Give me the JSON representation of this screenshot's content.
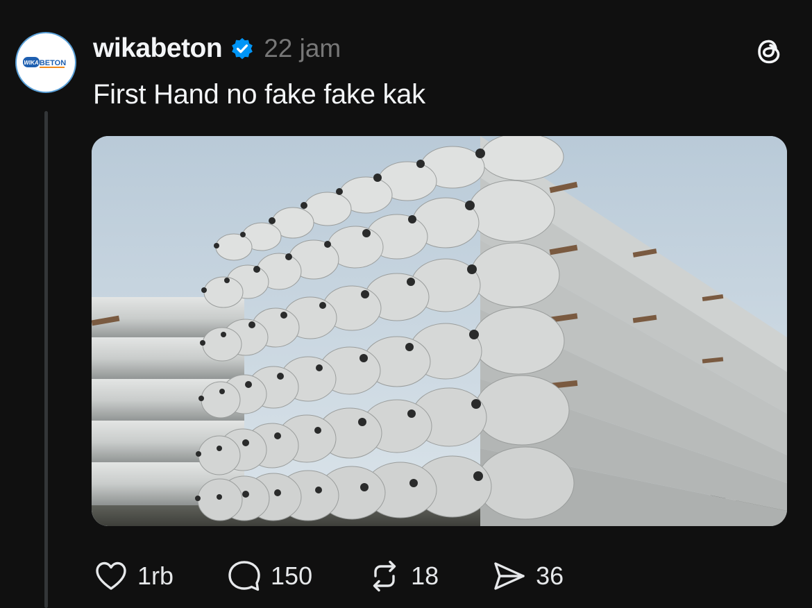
{
  "post": {
    "username": "wikabeton",
    "verified": true,
    "timestamp": "22 jam",
    "text": "First Hand no fake fake kak",
    "avatar": {
      "logo_prefix": "WIKA",
      "logo_suffix": "BETON",
      "colors": {
        "blue": "#1e5fb0",
        "orange": "#f28a1c",
        "ring": "#5aa0d8"
      }
    },
    "image_icon": "stacked-concrete-piles-photo"
  },
  "actions": {
    "like": {
      "icon": "heart-icon",
      "count": "1rb"
    },
    "reply": {
      "icon": "speech-bubble-icon",
      "count": "150"
    },
    "repost": {
      "icon": "repost-arrows-icon",
      "count": "18"
    },
    "share": {
      "icon": "paper-plane-icon",
      "count": "36"
    }
  },
  "theme": {
    "background": "#101010",
    "text": "#f3f5f7",
    "muted": "#777777",
    "verified_blue": "#0095f6",
    "thread_line": "#333638"
  }
}
